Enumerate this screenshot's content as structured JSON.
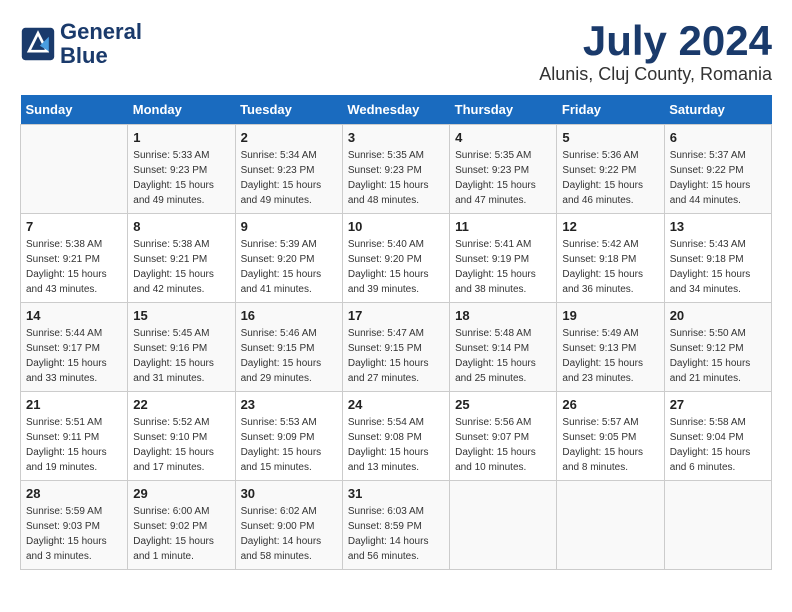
{
  "header": {
    "logo_line1": "General",
    "logo_line2": "Blue",
    "month_title": "July 2024",
    "location": "Alunis, Cluj County, Romania"
  },
  "weekdays": [
    "Sunday",
    "Monday",
    "Tuesday",
    "Wednesday",
    "Thursday",
    "Friday",
    "Saturday"
  ],
  "weeks": [
    [
      {
        "day": "",
        "info": ""
      },
      {
        "day": "1",
        "info": "Sunrise: 5:33 AM\nSunset: 9:23 PM\nDaylight: 15 hours\nand 49 minutes."
      },
      {
        "day": "2",
        "info": "Sunrise: 5:34 AM\nSunset: 9:23 PM\nDaylight: 15 hours\nand 49 minutes."
      },
      {
        "day": "3",
        "info": "Sunrise: 5:35 AM\nSunset: 9:23 PM\nDaylight: 15 hours\nand 48 minutes."
      },
      {
        "day": "4",
        "info": "Sunrise: 5:35 AM\nSunset: 9:23 PM\nDaylight: 15 hours\nand 47 minutes."
      },
      {
        "day": "5",
        "info": "Sunrise: 5:36 AM\nSunset: 9:22 PM\nDaylight: 15 hours\nand 46 minutes."
      },
      {
        "day": "6",
        "info": "Sunrise: 5:37 AM\nSunset: 9:22 PM\nDaylight: 15 hours\nand 44 minutes."
      }
    ],
    [
      {
        "day": "7",
        "info": "Sunrise: 5:38 AM\nSunset: 9:21 PM\nDaylight: 15 hours\nand 43 minutes."
      },
      {
        "day": "8",
        "info": "Sunrise: 5:38 AM\nSunset: 9:21 PM\nDaylight: 15 hours\nand 42 minutes."
      },
      {
        "day": "9",
        "info": "Sunrise: 5:39 AM\nSunset: 9:20 PM\nDaylight: 15 hours\nand 41 minutes."
      },
      {
        "day": "10",
        "info": "Sunrise: 5:40 AM\nSunset: 9:20 PM\nDaylight: 15 hours\nand 39 minutes."
      },
      {
        "day": "11",
        "info": "Sunrise: 5:41 AM\nSunset: 9:19 PM\nDaylight: 15 hours\nand 38 minutes."
      },
      {
        "day": "12",
        "info": "Sunrise: 5:42 AM\nSunset: 9:18 PM\nDaylight: 15 hours\nand 36 minutes."
      },
      {
        "day": "13",
        "info": "Sunrise: 5:43 AM\nSunset: 9:18 PM\nDaylight: 15 hours\nand 34 minutes."
      }
    ],
    [
      {
        "day": "14",
        "info": "Sunrise: 5:44 AM\nSunset: 9:17 PM\nDaylight: 15 hours\nand 33 minutes."
      },
      {
        "day": "15",
        "info": "Sunrise: 5:45 AM\nSunset: 9:16 PM\nDaylight: 15 hours\nand 31 minutes."
      },
      {
        "day": "16",
        "info": "Sunrise: 5:46 AM\nSunset: 9:15 PM\nDaylight: 15 hours\nand 29 minutes."
      },
      {
        "day": "17",
        "info": "Sunrise: 5:47 AM\nSunset: 9:15 PM\nDaylight: 15 hours\nand 27 minutes."
      },
      {
        "day": "18",
        "info": "Sunrise: 5:48 AM\nSunset: 9:14 PM\nDaylight: 15 hours\nand 25 minutes."
      },
      {
        "day": "19",
        "info": "Sunrise: 5:49 AM\nSunset: 9:13 PM\nDaylight: 15 hours\nand 23 minutes."
      },
      {
        "day": "20",
        "info": "Sunrise: 5:50 AM\nSunset: 9:12 PM\nDaylight: 15 hours\nand 21 minutes."
      }
    ],
    [
      {
        "day": "21",
        "info": "Sunrise: 5:51 AM\nSunset: 9:11 PM\nDaylight: 15 hours\nand 19 minutes."
      },
      {
        "day": "22",
        "info": "Sunrise: 5:52 AM\nSunset: 9:10 PM\nDaylight: 15 hours\nand 17 minutes."
      },
      {
        "day": "23",
        "info": "Sunrise: 5:53 AM\nSunset: 9:09 PM\nDaylight: 15 hours\nand 15 minutes."
      },
      {
        "day": "24",
        "info": "Sunrise: 5:54 AM\nSunset: 9:08 PM\nDaylight: 15 hours\nand 13 minutes."
      },
      {
        "day": "25",
        "info": "Sunrise: 5:56 AM\nSunset: 9:07 PM\nDaylight: 15 hours\nand 10 minutes."
      },
      {
        "day": "26",
        "info": "Sunrise: 5:57 AM\nSunset: 9:05 PM\nDaylight: 15 hours\nand 8 minutes."
      },
      {
        "day": "27",
        "info": "Sunrise: 5:58 AM\nSunset: 9:04 PM\nDaylight: 15 hours\nand 6 minutes."
      }
    ],
    [
      {
        "day": "28",
        "info": "Sunrise: 5:59 AM\nSunset: 9:03 PM\nDaylight: 15 hours\nand 3 minutes."
      },
      {
        "day": "29",
        "info": "Sunrise: 6:00 AM\nSunset: 9:02 PM\nDaylight: 15 hours\nand 1 minute."
      },
      {
        "day": "30",
        "info": "Sunrise: 6:02 AM\nSunset: 9:00 PM\nDaylight: 14 hours\nand 58 minutes."
      },
      {
        "day": "31",
        "info": "Sunrise: 6:03 AM\nSunset: 8:59 PM\nDaylight: 14 hours\nand 56 minutes."
      },
      {
        "day": "",
        "info": ""
      },
      {
        "day": "",
        "info": ""
      },
      {
        "day": "",
        "info": ""
      }
    ]
  ]
}
